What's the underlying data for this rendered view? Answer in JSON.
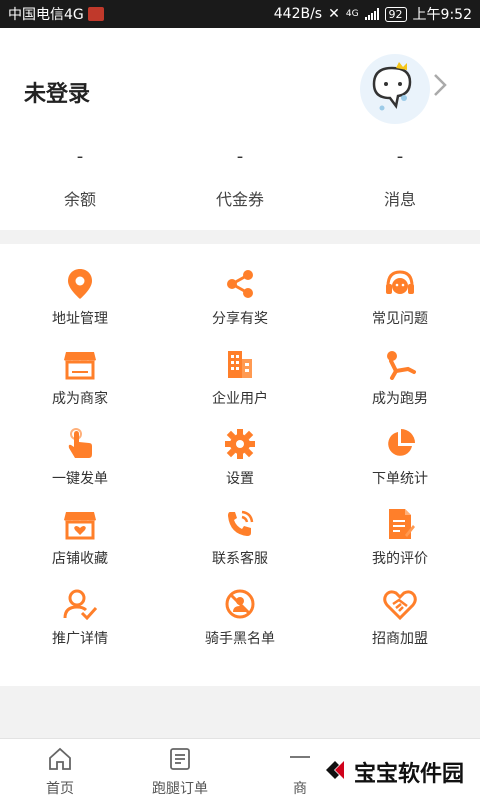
{
  "status_bar": {
    "carrier": "中国电信4G",
    "speed": "442B/s",
    "network": "4G",
    "battery": "92",
    "time": "上午9:52"
  },
  "profile": {
    "title": "未登录",
    "avatar_icon": "cartoon-avatar-icon",
    "chevron_icon": "chevron-right-icon"
  },
  "stats": [
    {
      "value": "-",
      "label": "余额"
    },
    {
      "value": "-",
      "label": "代金券"
    },
    {
      "value": "-",
      "label": "消息"
    }
  ],
  "accent_color": "#ff7f2a",
  "menu": [
    {
      "label": "地址管理",
      "icon": "location-pin-icon"
    },
    {
      "label": "分享有奖",
      "icon": "share-icon"
    },
    {
      "label": "常见问题",
      "icon": "headset-icon"
    },
    {
      "label": "成为商家",
      "icon": "storefront-icon"
    },
    {
      "label": "企业用户",
      "icon": "building-icon"
    },
    {
      "label": "成为跑男",
      "icon": "runner-icon"
    },
    {
      "label": "一键发单",
      "icon": "tap-hand-icon"
    },
    {
      "label": "设置",
      "icon": "gear-icon"
    },
    {
      "label": "下单统计",
      "icon": "pie-chart-icon"
    },
    {
      "label": "店铺收藏",
      "icon": "favorite-store-icon"
    },
    {
      "label": "联系客服",
      "icon": "phone-call-icon"
    },
    {
      "label": "我的评价",
      "icon": "review-document-icon"
    },
    {
      "label": "推广详情",
      "icon": "user-check-icon"
    },
    {
      "label": "骑手黑名单",
      "icon": "block-user-icon"
    },
    {
      "label": "招商加盟",
      "icon": "handshake-heart-icon"
    }
  ],
  "tabs": [
    {
      "label": "首页",
      "icon": "home-icon"
    },
    {
      "label": "跑腿订单",
      "icon": "order-list-icon"
    },
    {
      "label": "商",
      "icon": "store-tab-icon"
    }
  ],
  "watermark": {
    "text": "宝宝软件园"
  }
}
